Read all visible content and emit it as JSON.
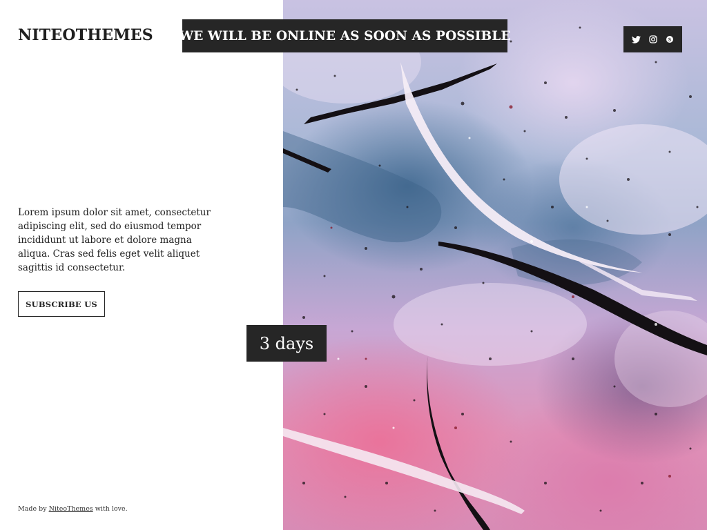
{
  "brand": "NITEOTHEMES",
  "headline": "WE WILL BE ONLINE AS SOON AS POSSIBLE",
  "description": "Lorem ipsum dolor sit amet, consectetur adipiscing elit, sed do eiusmod tempor incididunt ut labore et dolore magna aliqua. Cras sed felis eget velit aliquet sagittis id consectetur.",
  "subscribe_label": "SUBSCRIBE US",
  "countdown": "3 days",
  "footer": {
    "prefix": "Made by",
    "link": "NiteoThemes",
    "suffix": "with love."
  },
  "social": [
    {
      "icon": "twitter-icon"
    },
    {
      "icon": "instagram-icon"
    },
    {
      "icon": "skype-icon"
    }
  ],
  "colors": {
    "dark_box": "#262626",
    "text": "#1f1f1f",
    "background": "#ffffff"
  }
}
